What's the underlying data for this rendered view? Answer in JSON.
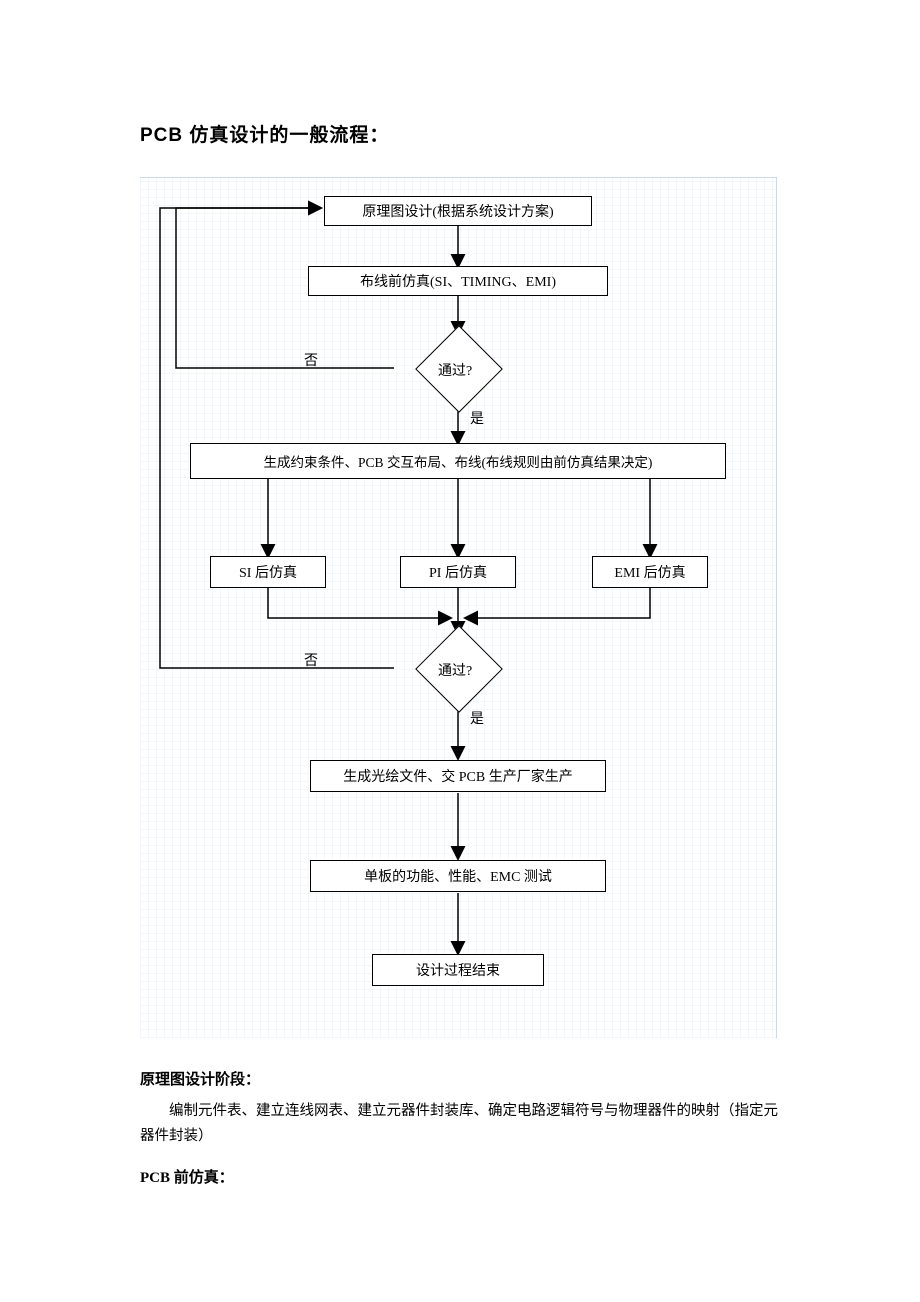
{
  "title": "PCB 仿真设计的一般流程：",
  "chart_data": {
    "type": "flowchart",
    "nodes": [
      {
        "id": "n1",
        "type": "process",
        "label": "原理图设计(根据系统设计方案)"
      },
      {
        "id": "n2",
        "type": "process",
        "label": "布线前仿真(SI、TIMING、EMI)"
      },
      {
        "id": "d1",
        "type": "decision",
        "label": "通过?"
      },
      {
        "id": "n3",
        "type": "process",
        "label": "生成约束条件、PCB 交互布局、布线(布线规则由前仿真结果决定)"
      },
      {
        "id": "n4a",
        "type": "process",
        "label": "SI 后仿真"
      },
      {
        "id": "n4b",
        "type": "process",
        "label": "PI 后仿真"
      },
      {
        "id": "n4c",
        "type": "process",
        "label": "EMI 后仿真"
      },
      {
        "id": "d2",
        "type": "decision",
        "label": "通过?"
      },
      {
        "id": "n5",
        "type": "process",
        "label": "生成光绘文件、交 PCB 生产厂家生产"
      },
      {
        "id": "n6",
        "type": "process",
        "label": "单板的功能、性能、EMC 测试"
      },
      {
        "id": "n7",
        "type": "terminal",
        "label": "设计过程结束"
      }
    ],
    "edges": [
      {
        "from": "n1",
        "to": "n2",
        "label": ""
      },
      {
        "from": "n2",
        "to": "d1",
        "label": ""
      },
      {
        "from": "d1",
        "to": "n1",
        "label": "否"
      },
      {
        "from": "d1",
        "to": "n3",
        "label": "是"
      },
      {
        "from": "n3",
        "to": "n4a",
        "label": ""
      },
      {
        "from": "n3",
        "to": "n4b",
        "label": ""
      },
      {
        "from": "n3",
        "to": "n4c",
        "label": ""
      },
      {
        "from": "n4a",
        "to": "d2",
        "label": ""
      },
      {
        "from": "n4b",
        "to": "d2",
        "label": ""
      },
      {
        "from": "n4c",
        "to": "d2",
        "label": ""
      },
      {
        "from": "d2",
        "to": "n1",
        "label": "否"
      },
      {
        "from": "d2",
        "to": "n5",
        "label": "是"
      },
      {
        "from": "n5",
        "to": "n6",
        "label": ""
      },
      {
        "from": "n6",
        "to": "n7",
        "label": ""
      }
    ],
    "labels": {
      "no": "否",
      "yes": "是"
    }
  },
  "sections": {
    "s1_title": "原理图设计阶段：",
    "s1_body": "编制元件表、建立连线网表、建立元器件封装库、确定电路逻辑符号与物理器件的映射（指定元器件封装）",
    "s2_title": "PCB 前仿真："
  }
}
